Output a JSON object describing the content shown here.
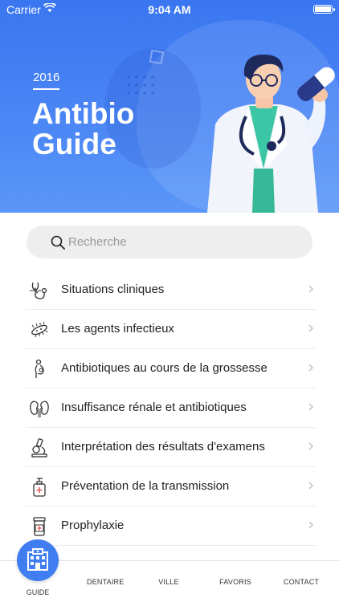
{
  "status_bar": {
    "carrier": "Carrier",
    "time": "9:04 AM"
  },
  "header": {
    "year": "2016",
    "title_line1": "Antibio",
    "title_line2": "Guide"
  },
  "search": {
    "placeholder": "Recherche"
  },
  "menu": {
    "items": [
      {
        "label": "Situations cliniques",
        "icon": "stethoscope-icon"
      },
      {
        "label": "Les agents infectieux",
        "icon": "bacteria-icon"
      },
      {
        "label": "Antibiotiques au cours de la grossesse",
        "icon": "pregnancy-icon"
      },
      {
        "label": "Insuffisance rénale et antibiotiques",
        "icon": "kidney-icon"
      },
      {
        "label": "Interprétation des résultats d'examens",
        "icon": "microscope-icon"
      },
      {
        "label": "Préventation de la transmission",
        "icon": "sanitizer-icon"
      },
      {
        "label": "Prophylaxie",
        "icon": "pill-bottle-icon"
      }
    ]
  },
  "tabbar": {
    "guide": "GUIDE",
    "dentaire": "DENTAIRE",
    "ville": "VILLE",
    "favoris": "FAVORIS",
    "contact": "CONTACT"
  },
  "colors": {
    "primary": "#3f7df1",
    "header_top": "#3a76f0",
    "text": "#222222"
  }
}
